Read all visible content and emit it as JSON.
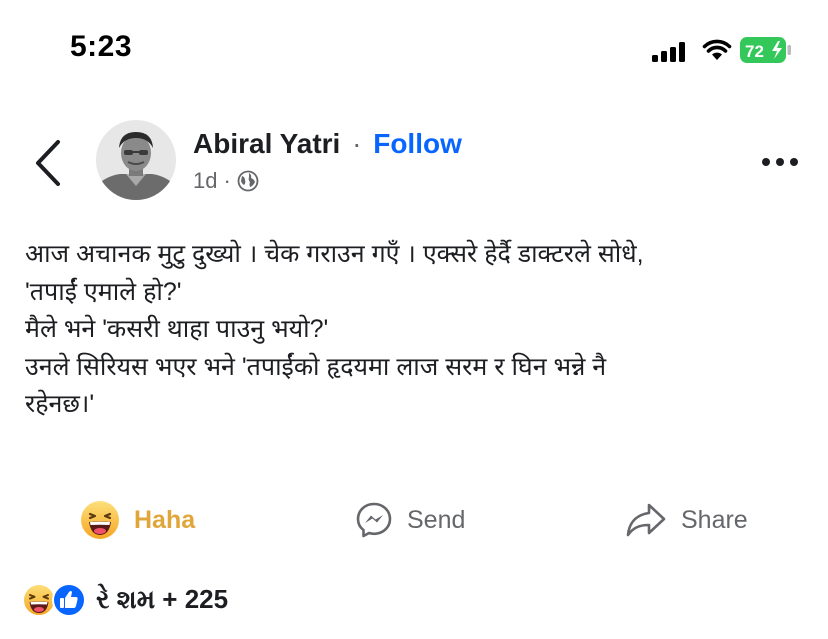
{
  "status_bar": {
    "time": "5:23",
    "battery": "72",
    "icons": [
      "cellular-signal-icon",
      "wifi-icon",
      "battery-charging-icon"
    ],
    "battery_color": "#34c759"
  },
  "header": {
    "back_icon": "chevron-left-icon",
    "author_name": "Abiral Yatri",
    "separator": "·",
    "follow_label": "Follow",
    "age": "1d",
    "meta_separator": "·",
    "privacy_icon": "globe-icon",
    "more_icon": "more-dots-icon"
  },
  "post": {
    "lines": [
      "आज अचानक मुटु दुख्यो । चेक गराउन गएँ । एक्सरे हेर्दै डाक्टरले सोधे,",
      "'तपाईं एमाले हो?'",
      "मैले भने 'कसरी थाहा पाउनु भयो?'",
      "उनले सिरियस भएर भने 'तपाईंको हृदयमा लाज सरम र घिन भन्ने नै",
      "रहेनछ।'"
    ]
  },
  "actions": {
    "haha_label": "Haha",
    "send_label": "Send",
    "share_label": "Share",
    "haha_color": "#e0a63a",
    "secondary_color": "#65676b"
  },
  "reactions": {
    "icons": [
      "haha-reaction-icon",
      "like-reaction-icon"
    ],
    "summary": "રે શમ + 225"
  },
  "colors": {
    "accent": "#0866ff",
    "text": "#1c1e21",
    "muted": "#65676b"
  }
}
